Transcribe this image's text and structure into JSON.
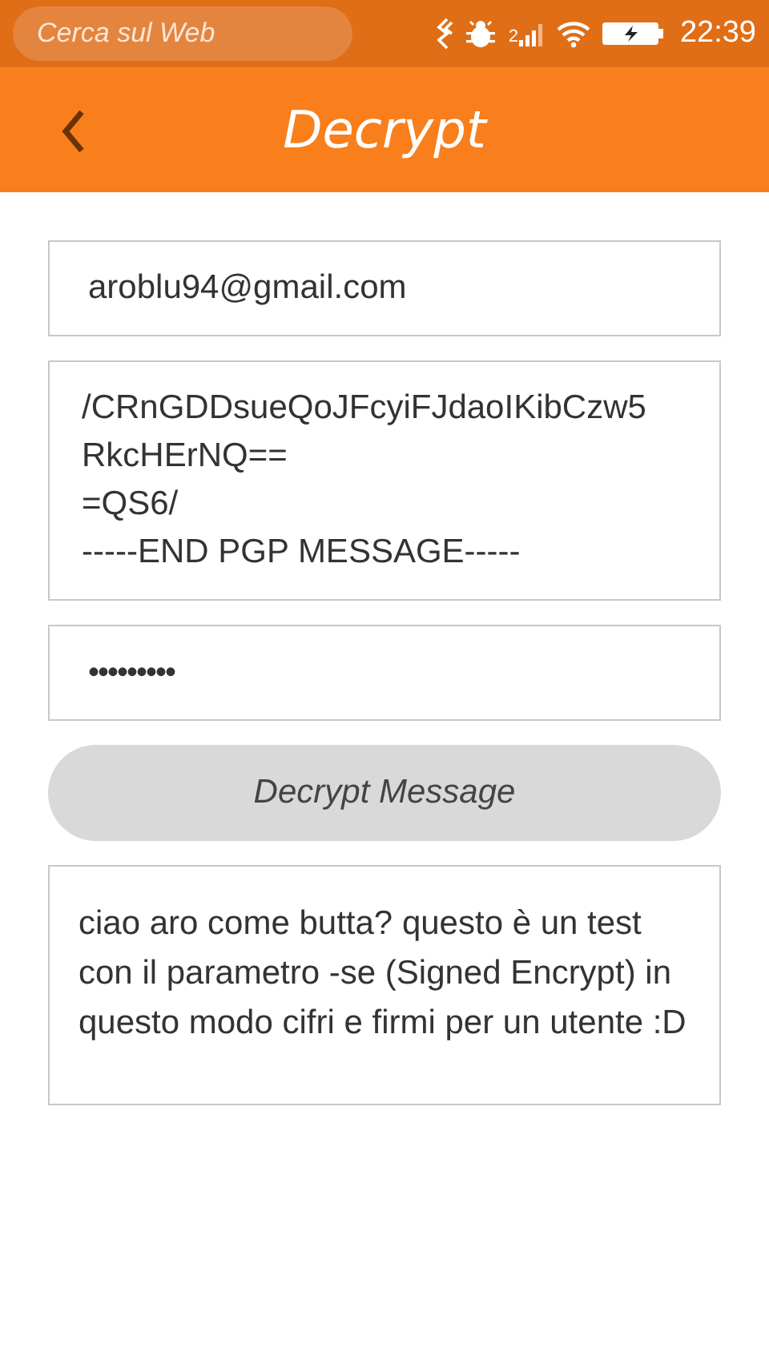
{
  "status_bar": {
    "search": {
      "placeholder": "Cerca sul Web"
    },
    "signal_label": "2",
    "time": "22:39"
  },
  "header": {
    "title": "Decrypt"
  },
  "fields": [
    {
      "kind": "input",
      "value": "aroblu94@gmail.com"
    },
    {
      "kind": "textarea",
      "value": "/CRnGDDsueQoJFcyiFJdaoIKibCzw5\nRkcHErNQ==\n=QS6/\n-----END PGP MESSAGE-----"
    },
    {
      "kind": "password",
      "value": "•••••••••"
    }
  ],
  "decrypt_button": {
    "label": "Decrypt Message"
  },
  "output": {
    "value": "ciao aro come butta? questo è un test con il parametro -se (Signed Encrypt) in questo modo cifri e firmi per un utente :D"
  }
}
